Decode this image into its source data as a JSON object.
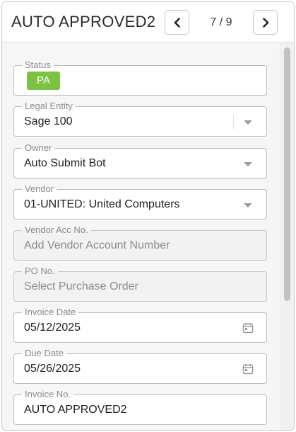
{
  "header": {
    "title": "AUTO APPROVED2",
    "pager": "7 / 9"
  },
  "form": {
    "status": {
      "label": "Status",
      "badge": "PA",
      "badge_color": "#7cc242"
    },
    "legal_entity": {
      "label": "Legal Entity",
      "value": "Sage 100"
    },
    "owner": {
      "label": "Owner",
      "value": "Auto Submit Bot"
    },
    "vendor": {
      "label": "Vendor",
      "value": "01-UNITED: United Computers"
    },
    "vendor_acc": {
      "label": "Vendor Acc No.",
      "placeholder": "Add Vendor Account Number"
    },
    "po_no": {
      "label": "PO No.",
      "placeholder": "Select Purchase Order"
    },
    "invoice_date": {
      "label": "Invoice Date",
      "value": "05/12/2025"
    },
    "due_date": {
      "label": "Due Date",
      "value": "05/26/2025"
    },
    "invoice_no": {
      "label": "Invoice No.",
      "value": "AUTO APPROVED2"
    }
  },
  "icons": {
    "prev": "chevron-left-icon",
    "next": "chevron-right-icon",
    "dropdown": "caret-down-icon",
    "calendar": "calendar-icon"
  }
}
